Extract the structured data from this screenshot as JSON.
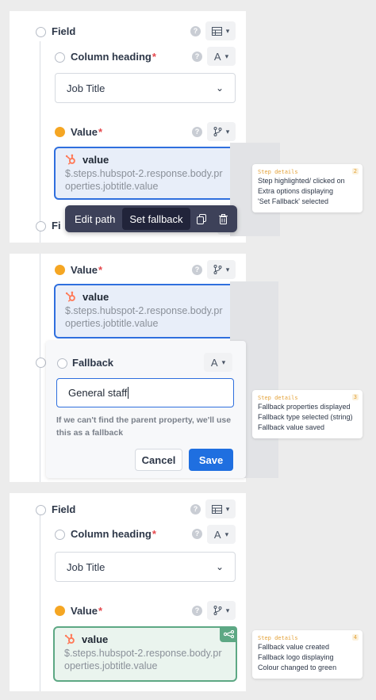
{
  "labels": {
    "field": "Field",
    "column_heading": "Column heading",
    "value": "Value",
    "fallback": "Fallback",
    "required_mark": "*",
    "help": "?",
    "field_cut": "Fi"
  },
  "column_heading_select": {
    "value": "Job Title"
  },
  "value_box": {
    "title": "value",
    "path": "$.steps.hubspot-2.response.body.properties.jobtitle.value"
  },
  "type_buttons": {
    "text": "A",
    "dropdown": "▾"
  },
  "toolbar": {
    "edit_path": "Edit path",
    "set_fallback": "Set fallback"
  },
  "fallback_form": {
    "input_value": "General staff",
    "hint": "If we can't find the parent property, we'll use this as a fallback",
    "cancel": "Cancel",
    "save": "Save"
  },
  "notes": [
    {
      "title": "Step details",
      "number": "2",
      "lines": [
        "Step highlighted/ clicked on",
        "Extra options displaying",
        "'Set Fallback' selected"
      ]
    },
    {
      "title": "Step details",
      "number": "3",
      "lines": [
        "Fallback properties displayed",
        "Fallback type selected (string)",
        "Fallback value saved"
      ]
    },
    {
      "title": "Step details",
      "number": "4",
      "lines": [
        "Fallback value created",
        "Fallback logo displaying",
        "Colour changed to green"
      ]
    }
  ],
  "colors": {
    "accent_blue": "#2f6fde",
    "required_red": "#e5484d",
    "pending_orange": "#f5a623",
    "fallback_green": "#5da884",
    "toolbar_dark": "#3d4159"
  },
  "icons": {
    "table": "table-icon",
    "branch": "branch-icon",
    "hubspot": "hubspot-icon",
    "copy": "copy-icon",
    "trash": "trash-icon",
    "fallback": "fallback-flow-icon"
  }
}
